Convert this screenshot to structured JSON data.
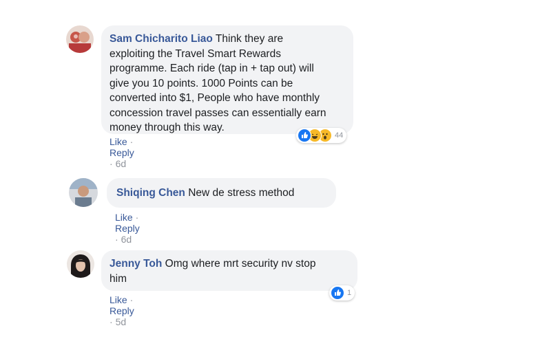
{
  "comments": [
    {
      "author": "Sam Chicharito Liao",
      "text_lines": [
        "Think they are",
        "exploiting the Travel Smart Rewards",
        "programme. Each ride (tap in + tap out) will",
        "give you 10 points. 1000 Points can be",
        "converted into $1, People who have monthly",
        "concession travel passes can essentially earn",
        "money through this way."
      ],
      "like_label": "Like",
      "reply_label": "Reply",
      "separator": "·",
      "time": "6d",
      "reaction_count": "44",
      "reactions": [
        "like-icon",
        "haha-icon",
        "wow-icon"
      ]
    },
    {
      "author": "Shiqing Chen",
      "text_lines": [
        "New de stress method"
      ],
      "like_label": "Like",
      "reply_label": "Reply",
      "separator": "·",
      "time": "6d"
    },
    {
      "author": "Jenny Toh",
      "text_lines": [
        "Omg where mrt security nv stop",
        "him"
      ],
      "like_label": "Like",
      "reply_label": "Reply",
      "separator": "·",
      "time": "5d",
      "reaction_count": "1",
      "reactions": [
        "like-icon"
      ]
    }
  ],
  "colors": {
    "author": "#385898",
    "bubble": "#f2f3f5",
    "like_blue": "#1877f2",
    "emoji_yellow": "#f7b928",
    "meta_gray": "#90949c"
  }
}
